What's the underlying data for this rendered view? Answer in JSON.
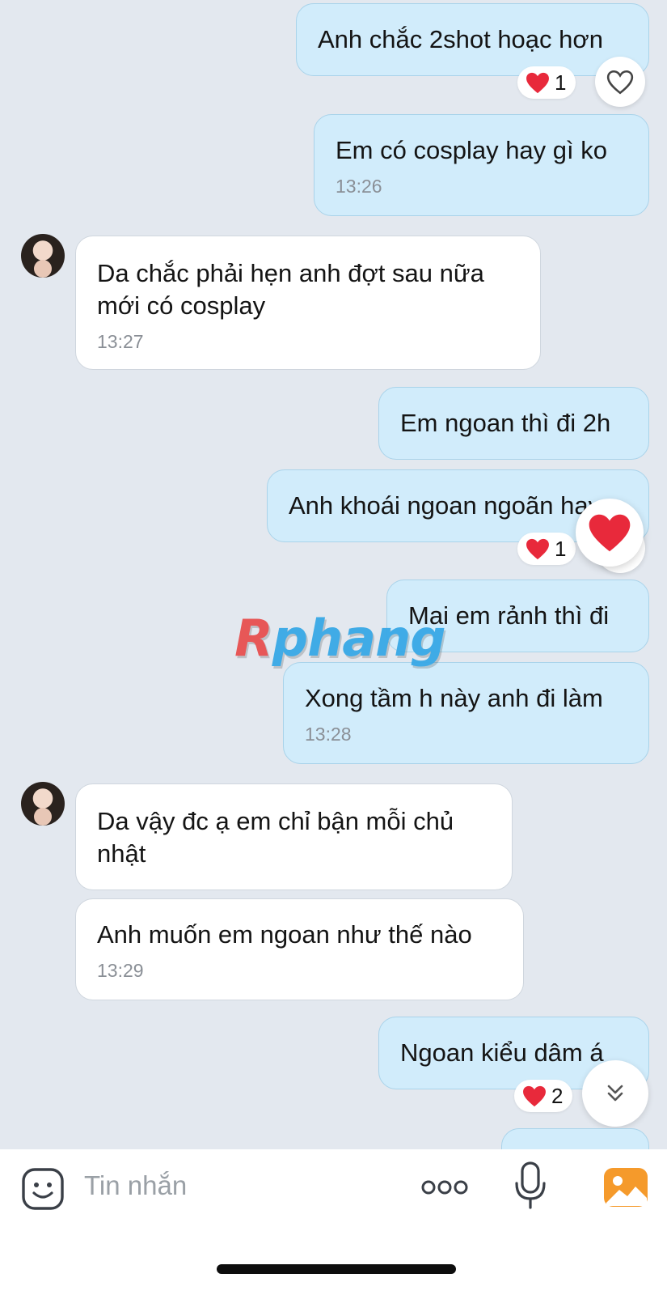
{
  "messages": [
    {
      "text": "Anh chắc 2shot hoạc hơn"
    },
    {
      "text": "Em có cosplay hay gì ko",
      "time": "13:26"
    },
    {
      "text": "Da chắc phải hẹn anh đợt sau nữa mới có cosplay",
      "time": "13:27"
    },
    {
      "text": "Em ngoan thì đi 2h"
    },
    {
      "text": "Anh khoái ngoan ngoãn hay"
    },
    {
      "text": "Mai em rảnh thì đi"
    },
    {
      "text": "Xong tầm h này anh đi làm",
      "time": "13:28"
    },
    {
      "text": "Da vậy đc ạ em chỉ bận mỗi chủ nhật"
    },
    {
      "text": "Anh muốn em ngoan như thế nào",
      "time": "13:29"
    },
    {
      "text": "Ngoan kiểu dâm á"
    }
  ],
  "reactions": [
    {
      "count": "1"
    },
    {
      "count": "1"
    },
    {
      "count": "2"
    }
  ],
  "watermark": {
    "first": "R",
    "rest": "phang"
  },
  "input": {
    "placeholder": "Tin nhắn"
  },
  "colors": {
    "sent_bubble": "#d1ecfb",
    "received_bubble": "#ffffff",
    "background": "#e3e8ef",
    "heart": "#e8293b",
    "image_button": "#f59a2b"
  },
  "icons": {
    "react": "heart-outline-icon",
    "reaction": "heart-icon",
    "scroll": "chevron-double-down-icon",
    "sticker": "sticker-icon",
    "more": "more-dots-icon",
    "mic": "microphone-icon",
    "image": "image-icon"
  }
}
